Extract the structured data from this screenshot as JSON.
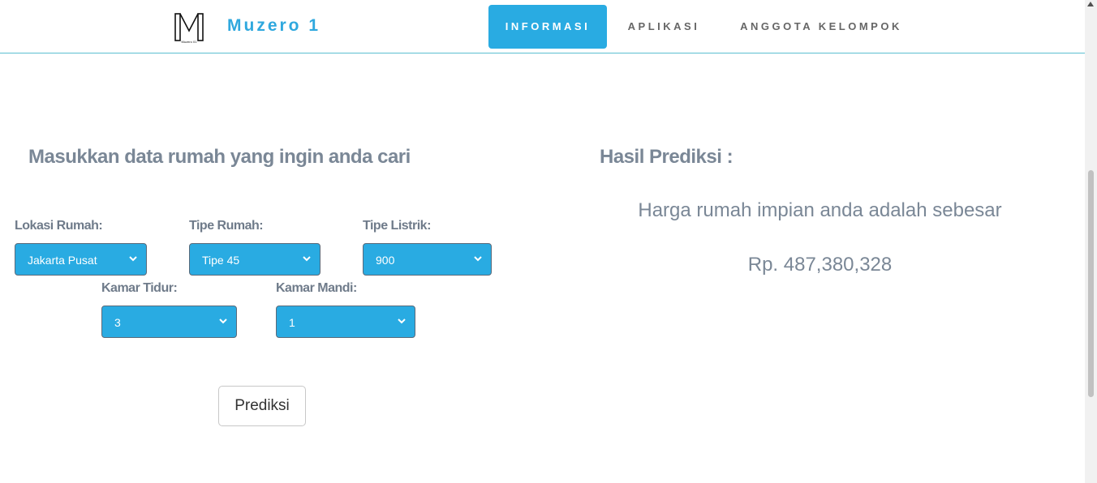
{
  "nav": {
    "brand": "Muzero 1",
    "logo_letter": "M",
    "logo_caption": "Muzero 01",
    "items": [
      {
        "label": "INFORMASI",
        "active": true
      },
      {
        "label": "APLIKASI",
        "active": false
      },
      {
        "label": "ANGGOTA KELOMPOK",
        "active": false
      }
    ]
  },
  "form": {
    "title": "Masukkan data rumah yang ingin anda cari",
    "fields": [
      {
        "label": "Lokasi Rumah:",
        "value": "Jakarta Pusat"
      },
      {
        "label": "Tipe Rumah:",
        "value": "Tipe 45"
      },
      {
        "label": "Tipe Listrik:",
        "value": "900"
      },
      {
        "label": "Kamar Tidur:",
        "value": "3"
      },
      {
        "label": "Kamar Mandi:",
        "value": "1"
      }
    ],
    "submit_label": "Prediksi"
  },
  "result": {
    "title": "Hasil Prediksi :",
    "description": "Harga rumah impian anda adalah sebesar",
    "price": "Rp. 487,380,328"
  },
  "colors": {
    "accent": "#29abe2",
    "text_muted": "#7a8796"
  }
}
